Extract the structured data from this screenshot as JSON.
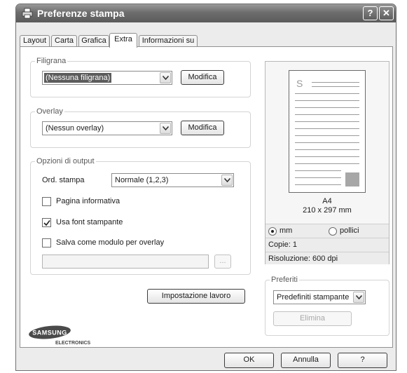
{
  "window": {
    "title": "Preferenze stampa",
    "help_button": "?",
    "close_button": "✕"
  },
  "tabs": [
    {
      "label": "Layout",
      "active": false
    },
    {
      "label": "Carta",
      "active": false
    },
    {
      "label": "Grafica",
      "active": false
    },
    {
      "label": "Extra",
      "active": true
    },
    {
      "label": "Informazioni su",
      "active": false
    }
  ],
  "watermark": {
    "group_label": "Filigrana",
    "selected": "(Nessuna filigrana)",
    "edit_button": "Modifica"
  },
  "overlay": {
    "group_label": "Overlay",
    "selected": "(Nessun overlay)",
    "edit_button": "Modifica"
  },
  "output": {
    "group_label": "Opzioni di output",
    "print_order_label": "Ord. stampa",
    "print_order_value": "Normale (1,2,3)",
    "info_page": {
      "label": "Pagina informativa",
      "checked": false
    },
    "printer_font": {
      "label": "Usa font stampante",
      "checked": true
    },
    "save_overlay": {
      "label": "Salva come modulo per overlay",
      "checked": false
    },
    "path_value": "",
    "browse_button": "..."
  },
  "job_settings_button": "Impostazione lavoro",
  "preview": {
    "paper_name": "A4",
    "paper_size": "210 x 297 mm",
    "unit_mm": "mm",
    "unit_inch": "pollici",
    "selected_unit": "mm",
    "copies": "Copie: 1",
    "resolution": "Risoluzione: 600 dpi",
    "page_letter": "S"
  },
  "favorites": {
    "group_label": "Preferiti",
    "selected": "Predefiniti stampante",
    "delete_button": "Elimina"
  },
  "logo": {
    "brand": "SAMSUNG",
    "sub": "ELECTRONICS"
  },
  "footer": {
    "ok": "OK",
    "cancel": "Annulla",
    "help": "?"
  }
}
